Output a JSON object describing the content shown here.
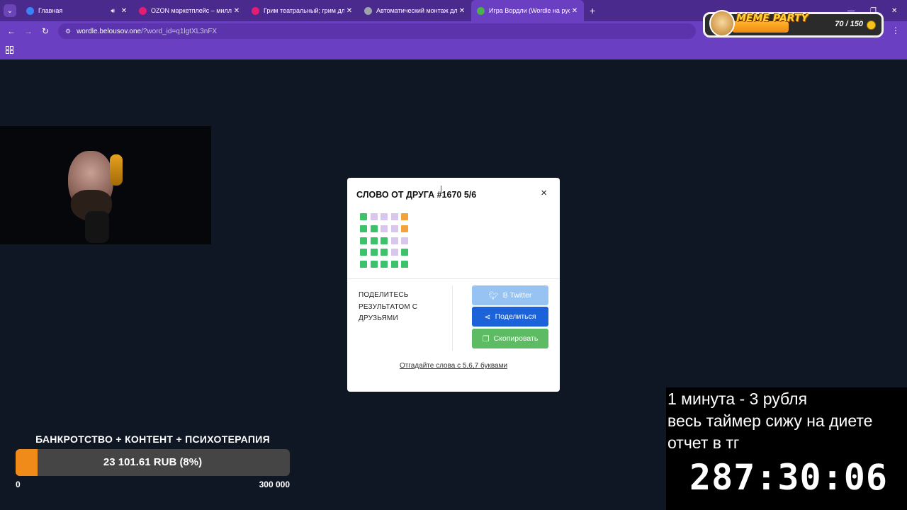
{
  "browser": {
    "tabs": [
      {
        "title": "Главная",
        "favicon_color": "#3b82f6",
        "audio": true,
        "active": false
      },
      {
        "title": "OZON маркетплейс – миллион",
        "favicon_color": "#e11d74",
        "audio": false,
        "active": false
      },
      {
        "title": "Грим театральный; грим для л",
        "favicon_color": "#e11d74",
        "audio": false,
        "active": false
      },
      {
        "title": "Автоматический монтаж для с",
        "favicon_color": "#9ca3af",
        "audio": false,
        "active": false
      },
      {
        "title": "Игра Вордли (Wordle на русс",
        "favicon_color": "#4caf50",
        "audio": false,
        "active": true
      }
    ],
    "url_host": "wordle.belousov.one",
    "url_path": "/?word_id=q1lgtXL3nFX"
  },
  "meme_widget": {
    "brand": "MEME PARTY",
    "count": "70 / 150"
  },
  "modal": {
    "title": "СЛОВО ОТ ДРУГА #1670 5/6",
    "close": "×",
    "grid": [
      [
        "g",
        "p",
        "p",
        "p",
        "o"
      ],
      [
        "g",
        "g",
        "p",
        "p",
        "o"
      ],
      [
        "g",
        "g",
        "g",
        "p",
        "p"
      ],
      [
        "g",
        "g",
        "g",
        "p",
        "g"
      ],
      [
        "g",
        "g",
        "g",
        "g",
        "g"
      ]
    ],
    "share_text": "ПОДЕЛИТЕСЬ РЕЗУЛЬТАТОМ С ДРУЗЬЯМИ",
    "buttons": {
      "twitter": "В Twitter",
      "share": "Поделиться",
      "copy": "Скопировать"
    },
    "link": "Отгадайте слова с 5,6,7 буквами"
  },
  "goal": {
    "title": "БАНКРОТСТВО + КОНТЕНТ + ПСИХОТЕРАПИЯ",
    "value": "23 101.61 RUB (8%)",
    "progress_percent": 8,
    "min": "0",
    "max": "300 000",
    "fill_color": "#f08a19"
  },
  "timer": {
    "line1": "1 минута - 3 рубля",
    "line2": "весь таймер сижу на диете",
    "line3": "отчет в тг",
    "clock": "287:30:06"
  }
}
